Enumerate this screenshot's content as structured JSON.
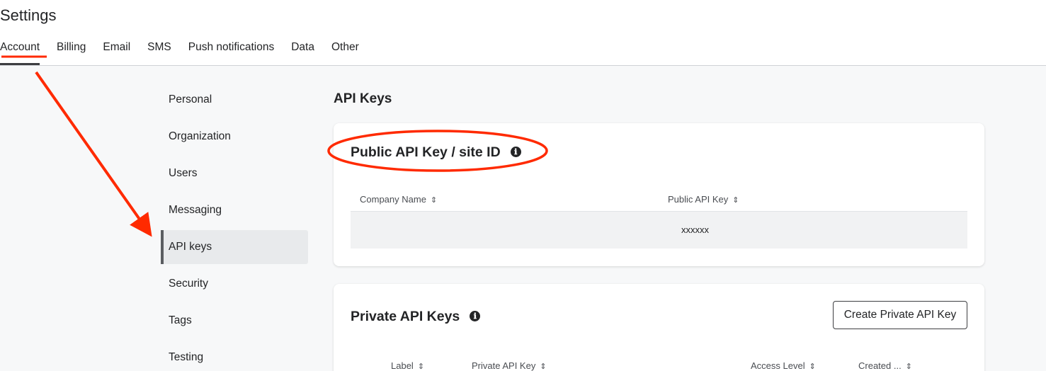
{
  "page": {
    "title": "Settings"
  },
  "tabs": [
    {
      "label": "Account",
      "active": true
    },
    {
      "label": "Billing"
    },
    {
      "label": "Email"
    },
    {
      "label": "SMS"
    },
    {
      "label": "Push notifications"
    },
    {
      "label": "Data"
    },
    {
      "label": "Other"
    }
  ],
  "sidebar": {
    "items": [
      {
        "label": "Personal"
      },
      {
        "label": "Organization"
      },
      {
        "label": "Users"
      },
      {
        "label": "Messaging"
      },
      {
        "label": "API keys",
        "active": true
      },
      {
        "label": "Security"
      },
      {
        "label": "Tags"
      },
      {
        "label": "Testing"
      }
    ]
  },
  "main": {
    "section_title": "API Keys",
    "public_card": {
      "heading": "Public API Key / site ID",
      "info_icon": "info-icon",
      "columns": [
        "Company Name",
        "Public API Key"
      ],
      "rows": [
        {
          "company_name": "",
          "public_api_key": "xxxxxx"
        }
      ]
    },
    "private_card": {
      "heading": "Private API Keys",
      "info_icon": "info-icon",
      "create_button": "Create Private API Key",
      "columns": [
        "Label",
        "Private API Key",
        "Access Level",
        "Created ..."
      ]
    }
  },
  "icons": {
    "info": "ℹ",
    "sort": "⇕"
  },
  "annotation": {
    "color": "#ff2a00"
  }
}
